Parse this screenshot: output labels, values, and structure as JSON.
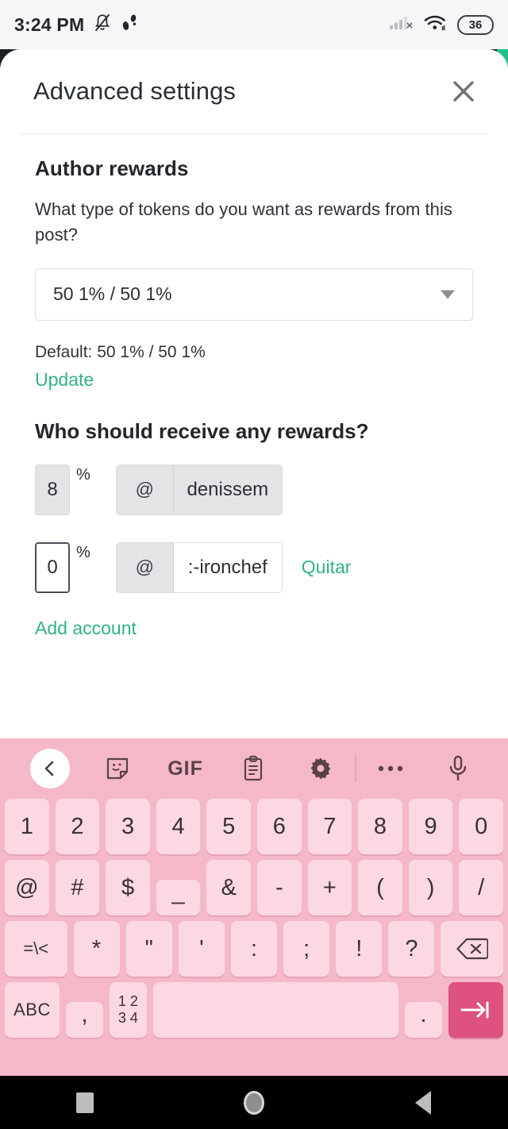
{
  "status_bar": {
    "time": "3:24 PM",
    "icons_left": [
      "bell-off-icon",
      "footsteps-icon"
    ],
    "icons_right": [
      "cellular-no-sim-icon",
      "wifi-icon"
    ],
    "battery_level": "36"
  },
  "sheet": {
    "title": "Advanced settings",
    "close_label": "✕",
    "author_rewards": {
      "heading": "Author rewards",
      "question": "What type of tokens do you want as rewards from this post?",
      "select_value": "50 1% / 50 1%",
      "default_text": "Default: 50 1% / 50 1%",
      "update_label": "Update"
    },
    "beneficiaries": {
      "heading": "Who should receive any rewards?",
      "percent_sign": "%",
      "at_sign": "@",
      "rows": [
        {
          "percent": "8",
          "account": "denissem",
          "remove_label": "",
          "state": "disabled"
        },
        {
          "percent": "0",
          "account": ":-ironchef",
          "remove_label": "Quitar",
          "state": "active"
        }
      ],
      "add_account_label": "Add account"
    }
  },
  "keyboard": {
    "toolbar": [
      {
        "name": "back-chevron-icon",
        "label": ""
      },
      {
        "name": "sticker-icon",
        "label": ""
      },
      {
        "name": "gif-icon",
        "label": "GIF"
      },
      {
        "name": "clipboard-icon",
        "label": ""
      },
      {
        "name": "gear-icon",
        "label": ""
      },
      {
        "name": "toolbar-divider",
        "label": ""
      },
      {
        "name": "more-options-icon",
        "label": ""
      },
      {
        "name": "microphone-icon",
        "label": ""
      }
    ],
    "row1": [
      "1",
      "2",
      "3",
      "4",
      "5",
      "6",
      "7",
      "8",
      "9",
      "0"
    ],
    "row2": [
      "@",
      "#",
      "$",
      "_",
      "&",
      "-",
      "+",
      "(",
      ")",
      "/"
    ],
    "row3": [
      "=\\<",
      "*",
      "\"",
      "'",
      ":",
      ";",
      "!",
      "?"
    ],
    "row3_backspace": "backspace-icon",
    "row4": {
      "abc": "ABC",
      "comma": ",",
      "numbers": "12\n34",
      "numbers_top": "1 2",
      "numbers_bottom": "3 4",
      "space": "",
      "period": ".",
      "enter": "→|"
    }
  },
  "nav_bar": {
    "recents": "recents-square-icon",
    "home": "home-circle-icon",
    "back": "back-triangle-icon"
  },
  "colors": {
    "accent_green": "#31b285",
    "keyboard_bg": "#f5b8c8",
    "key_bg": "#fbd8e2",
    "enter_key": "#dd527f",
    "teal_edge": "#23c08a"
  }
}
